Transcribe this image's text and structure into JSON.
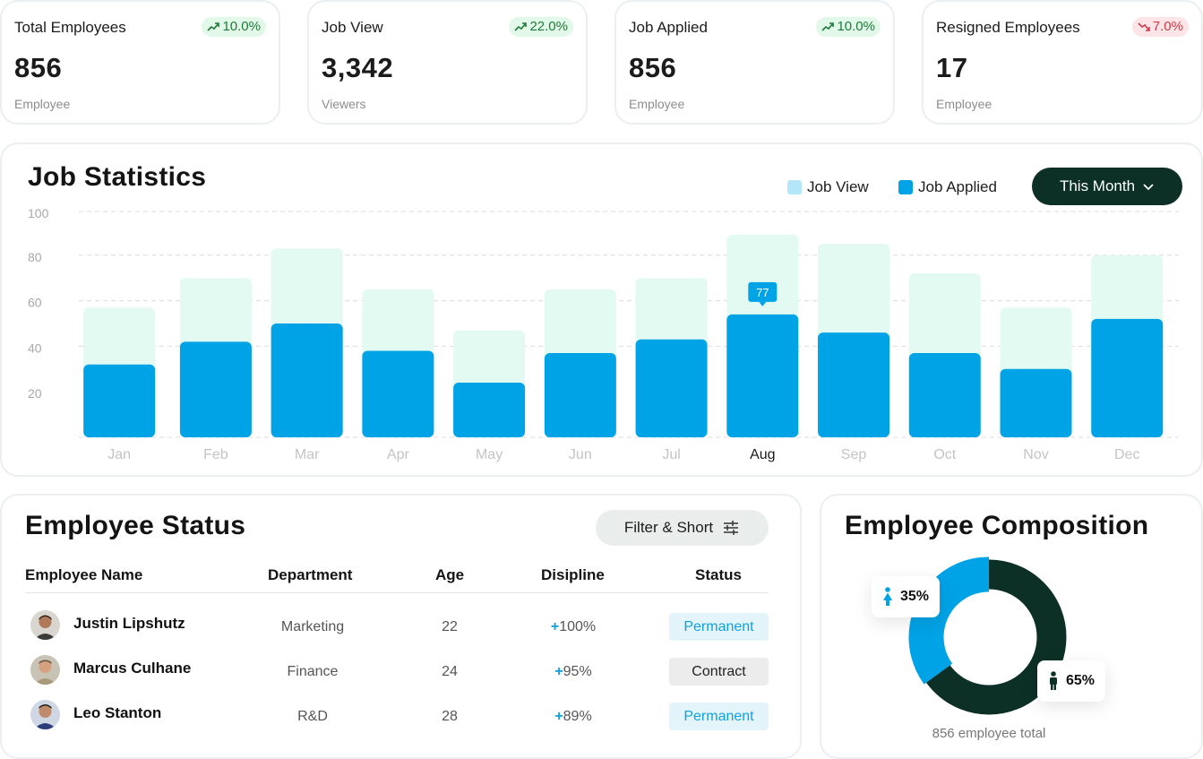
{
  "stats": [
    {
      "label": "Total Employees",
      "change": "10.0%",
      "trend": "up",
      "value": "856",
      "unit": "Employee"
    },
    {
      "label": "Job View",
      "change": "22.0%",
      "trend": "up",
      "value": "3,342",
      "unit": "Viewers"
    },
    {
      "label": "Job Applied",
      "change": "10.0%",
      "trend": "up",
      "value": "856",
      "unit": "Employee"
    },
    {
      "label": "Resigned Employees",
      "change": "7.0%",
      "trend": "down",
      "value": "17",
      "unit": "Employee"
    }
  ],
  "job_stats": {
    "title": "Job Statistics",
    "legend": {
      "view": "Job View",
      "applied": "Job Applied"
    },
    "period_button": "This Month",
    "highlight_label": "77"
  },
  "chart_data": {
    "type": "bar",
    "categories": [
      "Jan",
      "Feb",
      "Mar",
      "Apr",
      "May",
      "Jun",
      "Jul",
      "Aug",
      "Sep",
      "Oct",
      "Nov",
      "Dec"
    ],
    "series": [
      {
        "name": "Job View",
        "values": [
          57,
          70,
          83,
          65,
          47,
          65,
          70,
          89,
          85,
          72,
          57,
          80
        ]
      },
      {
        "name": "Job Applied",
        "values": [
          32,
          42,
          50,
          38,
          24,
          37,
          43,
          54,
          46,
          37,
          30,
          52
        ]
      }
    ],
    "yticks": [
      20,
      40,
      60,
      80,
      100
    ],
    "ylim": [
      0,
      100
    ],
    "highlight_index": 7,
    "colors": {
      "view": "#e2faf1",
      "applied": "#00a3e6",
      "grid": "#dcdcdc",
      "tick": "#a8a8a8",
      "highlight_text": "#1a1a1a"
    }
  },
  "employee_status": {
    "title": "Employee Status",
    "filter_button": "Filter & Short",
    "columns": [
      "Employee Name",
      "Department",
      "Age",
      "Disipline",
      "Status"
    ],
    "rows": [
      {
        "name": "Justin Lipshutz",
        "department": "Marketing",
        "age": "22",
        "discipline": "100%",
        "status": "Permanent",
        "status_type": "perm"
      },
      {
        "name": "Marcus Culhane",
        "department": "Finance",
        "age": "24",
        "discipline": "95%",
        "status": "Contract",
        "status_type": "contract"
      },
      {
        "name": "Leo Stanton",
        "department": "R&D",
        "age": "28",
        "discipline": "89%",
        "status": "Permanent",
        "status_type": "perm"
      }
    ]
  },
  "composition": {
    "title": "Employee Composition",
    "female_pct": "35%",
    "male_pct": "65%",
    "female_value": 35,
    "male_value": 65,
    "total_text": "856 employee total",
    "colors": {
      "female": "#00a3e6",
      "male": "#0c2f26"
    }
  }
}
